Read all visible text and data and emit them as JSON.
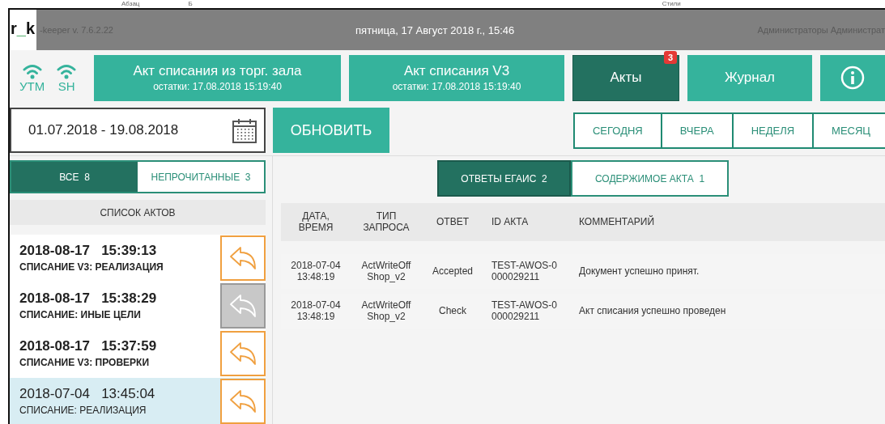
{
  "background_app": {
    "labels": [
      "Абзац",
      "Б",
      "Стили"
    ]
  },
  "title_bar": {
    "logo": "r_k",
    "version": "-keeper v. 7.6.2.22",
    "datetime": "пятница, 17 Август 2018 г., 15:46",
    "user": "Администраторы Администрат"
  },
  "status_icons": [
    {
      "label": "УТМ"
    },
    {
      "label": "SH"
    }
  ],
  "nav": [
    {
      "kind": "act",
      "title": "Акт списания из торг. зала",
      "subtitle": "остатки: 17.08.2018 15:19:40",
      "selected": false
    },
    {
      "kind": "act",
      "title": "Акт списания V3",
      "subtitle": "остатки: 17.08.2018 15:19:40",
      "selected": false
    },
    {
      "kind": "plain",
      "title": "Акты",
      "badge": "3",
      "selected": true
    },
    {
      "kind": "plain",
      "title": "Журнал",
      "selected": false
    },
    {
      "kind": "info",
      "selected": false
    }
  ],
  "date_range": {
    "value": "01.07.2018 - 19.08.2018"
  },
  "refresh_button": "ОБНОВИТЬ",
  "periods": [
    {
      "label": "СЕГОДНЯ",
      "selected": false
    },
    {
      "label": "ВЧЕРА",
      "selected": false
    },
    {
      "label": "НЕДЕЛЯ",
      "selected": false
    },
    {
      "label": "МЕСЯЦ",
      "selected": false
    }
  ],
  "filter_tabs": [
    {
      "label": "ВСЕ",
      "count": "8",
      "selected": true
    },
    {
      "label": "НЕПРОЧИТАННЫЕ",
      "count": "3",
      "selected": false
    }
  ],
  "acts_list": {
    "title": "СПИСОК АКТОВ",
    "items": [
      {
        "date": "2018-08-17",
        "time": "15:39:13",
        "type": "СПИСАНИЕ V3: РЕАЛИЗАЦИЯ",
        "unread": true,
        "selected": false,
        "reply_disabled": false
      },
      {
        "date": "2018-08-17",
        "time": "15:38:29",
        "type": "СПИСАНИЕ: ИНЫЕ ЦЕЛИ",
        "unread": true,
        "selected": false,
        "reply_disabled": true
      },
      {
        "date": "2018-08-17",
        "time": "15:37:59",
        "type": "СПИСАНИЕ V3: ПРОВЕРКИ",
        "unread": true,
        "selected": false,
        "reply_disabled": false
      },
      {
        "date": "2018-07-04",
        "time": "13:45:04",
        "type": "СПИСАНИЕ: РЕАЛИЗАЦИЯ",
        "unread": false,
        "selected": true,
        "reply_disabled": false
      }
    ]
  },
  "detail_tabs": [
    {
      "label": "ОТВЕТЫ ЕГАИС",
      "count": "2",
      "selected": true
    },
    {
      "label": "СОДЕРЖИМОЕ АКТА",
      "count": "1",
      "selected": false
    }
  ],
  "table": {
    "columns": [
      "ДАТА,\nВРЕМЯ",
      "ТИП\nЗАПРОСА",
      "ОТВЕТ",
      "ID АКТА",
      "КОММЕНТАРИЙ"
    ],
    "rows": [
      [
        "2018-07-04\n13:48:19",
        "ActWriteOff\nShop_v2",
        "Accepted",
        "TEST-AWOS-0\n000029211",
        "Документ успешно принят."
      ],
      [
        "2018-07-04\n13:48:19",
        "ActWriteOff\nShop_v2",
        "Check",
        "TEST-AWOS-0\n000029211",
        "Акт списания успешно проведен"
      ]
    ]
  }
}
